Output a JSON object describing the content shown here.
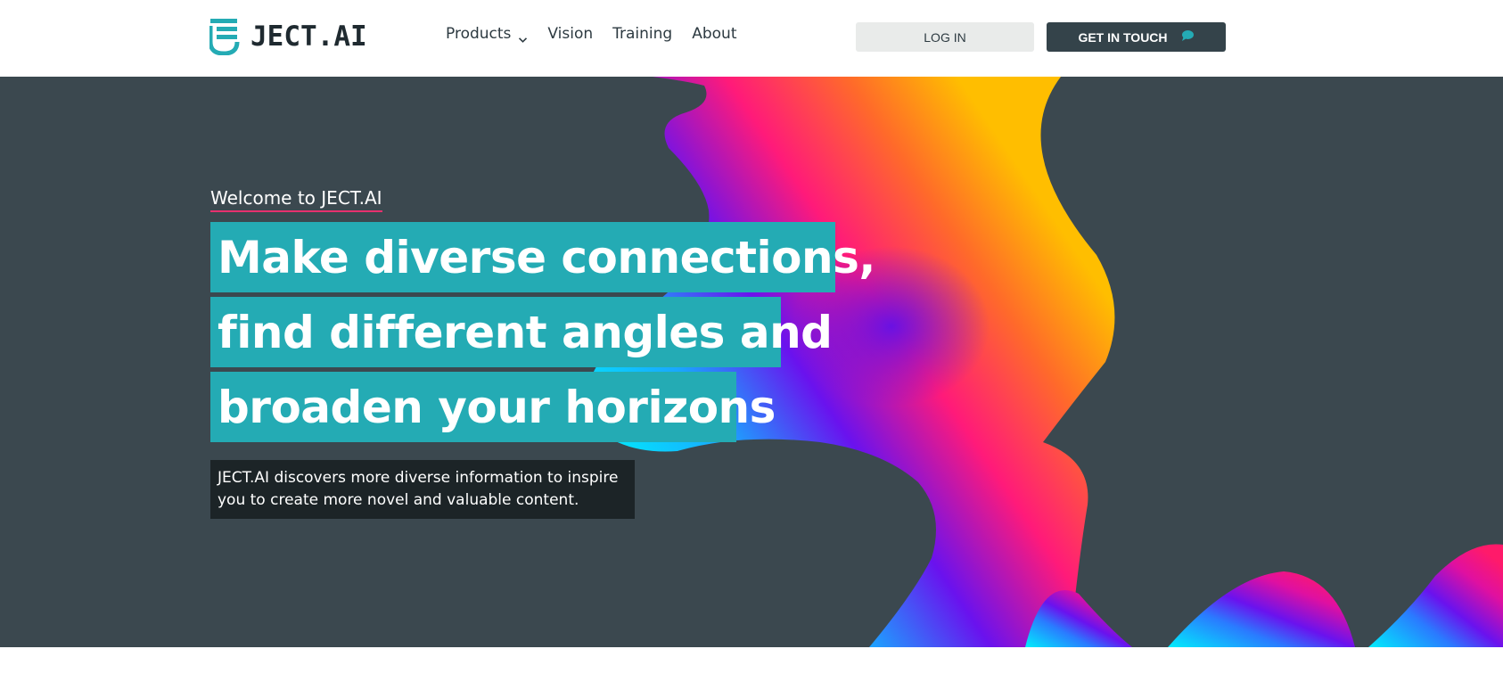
{
  "header": {
    "logo_text": "JECT.AI",
    "nav": [
      {
        "label": "Products",
        "has_dropdown": true
      },
      {
        "label": "Vision"
      },
      {
        "label": "Training"
      },
      {
        "label": "About"
      }
    ],
    "login_label": "LOG IN",
    "contact_label": "GET IN TOUCH"
  },
  "hero": {
    "eyebrow": "Welcome to JECT.AI",
    "headline_lines": [
      "Make diverse connections,",
      "find different angles and",
      "broaden your horizons"
    ],
    "description_lines": [
      "JECT.AI discovers more diverse information to inspire",
      "you to create more novel and valuable content."
    ]
  },
  "icons": {
    "logo": "logo-icon",
    "dropdown": "chevron-down-icon",
    "contact": "chat-bubble-icon"
  },
  "colors": {
    "brand_teal": "#24abb4",
    "hero_background": "#3b484f",
    "contact_button": "#34434a",
    "login_button": "#e9ebea",
    "eyebrow_underline": "#e8306e",
    "description_box": "#1c2427"
  }
}
